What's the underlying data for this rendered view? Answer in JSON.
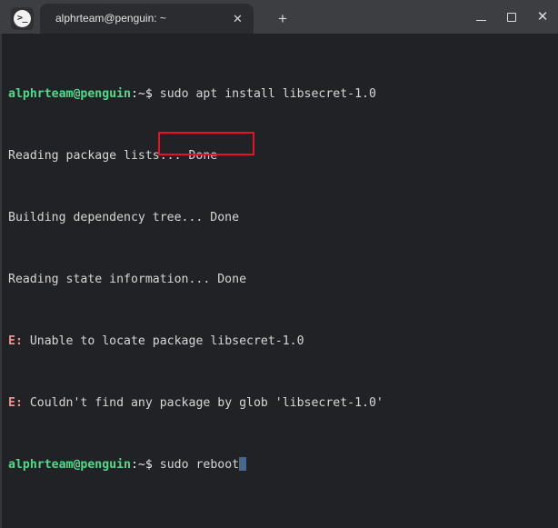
{
  "window": {
    "app_icon": "terminal-prompt-icon",
    "icon_glyph": ">_",
    "controls": {
      "minimize_label": "—",
      "maximize_label": "☐",
      "close_label": "✕"
    }
  },
  "tabs": {
    "active_index": 0,
    "items": [
      {
        "title": "alphrteam@penguin: ~",
        "close_label": "✕"
      }
    ],
    "new_tab_label": "+"
  },
  "terminal": {
    "colors": {
      "background": "#212226",
      "foreground": "#d6d6d6",
      "prompt_user": "#4ddb8b",
      "error": "#ef8f8f",
      "cursor": "#46688e",
      "titlebar": "#3d3e42",
      "tab_active": "#2b2c30",
      "annotation": "#e81123"
    },
    "prompt_user_host": "alphrteam@penguin",
    "prompt_path": ":~$",
    "lines": [
      {
        "type": "prompt",
        "user": "alphrteam@penguin",
        "path": ":~$",
        "command": " sudo apt install libsecret-1.0"
      },
      {
        "type": "output",
        "text": "Reading package lists... Done"
      },
      {
        "type": "output",
        "text": "Building dependency tree... Done"
      },
      {
        "type": "output",
        "text": "Reading state information... Done"
      },
      {
        "type": "error",
        "prefix": "E:",
        "text": " Unable to locate package libsecret-1.0"
      },
      {
        "type": "error",
        "prefix": "E:",
        "text": " Couldn't find any package by glob 'libsecret-1.0'"
      },
      {
        "type": "prompt",
        "user": "alphrteam@penguin",
        "path": ":~$",
        "command": " sudo reboot",
        "cursor": true
      }
    ]
  },
  "annotation": {
    "label": "highlight-sudo-reboot",
    "target_text": "sudo reboot"
  }
}
